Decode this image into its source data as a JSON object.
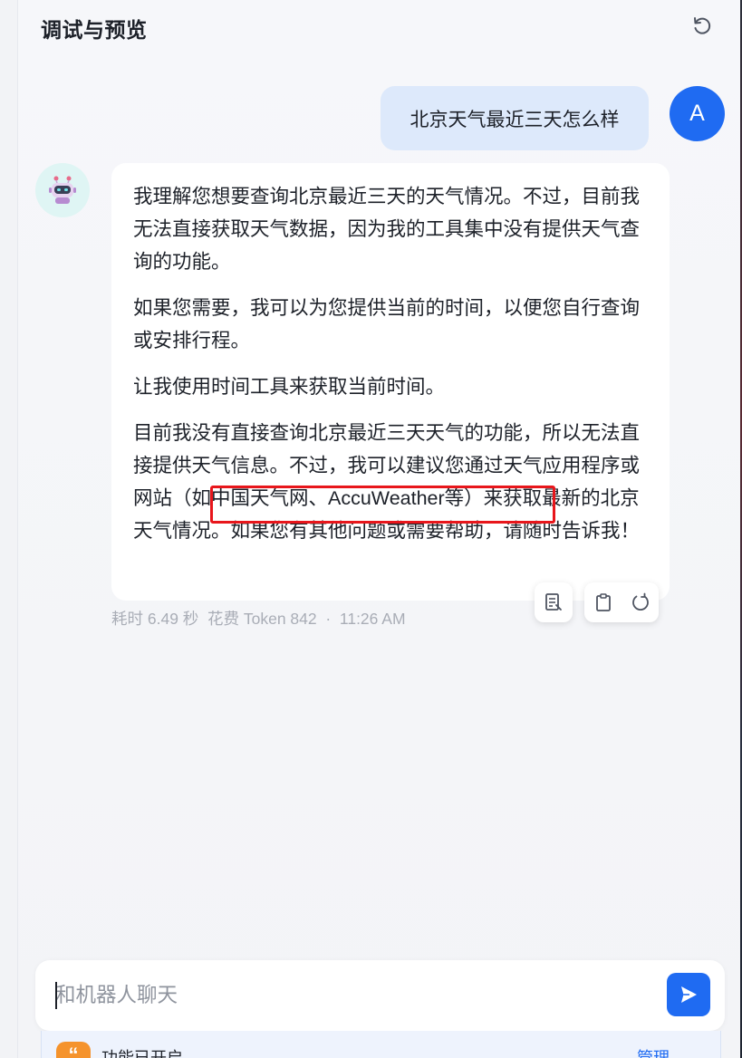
{
  "header": {
    "title": "调试与预览",
    "refresh_icon": "refresh-icon"
  },
  "user_message": {
    "text": "北京天气最近三天怎么样",
    "avatar_letter": "A",
    "avatar_color": "#1f6bf2"
  },
  "bot_message": {
    "avatar_icon": "robot-icon",
    "paragraphs": [
      "我理解您想要查询北京最近三天的天气情况。不过，目前我无法直接获取天气数据，因为我的工具集中没有提供天气查询的功能。",
      "如果您需要，我可以为您提供当前的时间，以便您自行查询或安排行程。",
      "让我使用时间工具来获取当前时间。",
      "目前我没有直接查询北京最近三天天气的功能，所以无法直接提供天气信息。不过，我可以建议您通过天气应用程序或网站（如中国天气网、AccuWeather等）来获取最新的北京天气情况。如果您有其他问题或需要帮助，请随时告诉我！"
    ],
    "meta": "耗时 6.49 秒  花费 Token 842  ·  11:26 AM",
    "highlight_color": "#e8161b",
    "actions": [
      "document-icon",
      "clipboard-icon",
      "regenerate-icon"
    ]
  },
  "input": {
    "placeholder": "和机器人聊天",
    "send_icon": "send-icon"
  },
  "feature_bar": {
    "icon": "quote-icon",
    "text": "功能已开启",
    "manage_label": "管理 →"
  }
}
